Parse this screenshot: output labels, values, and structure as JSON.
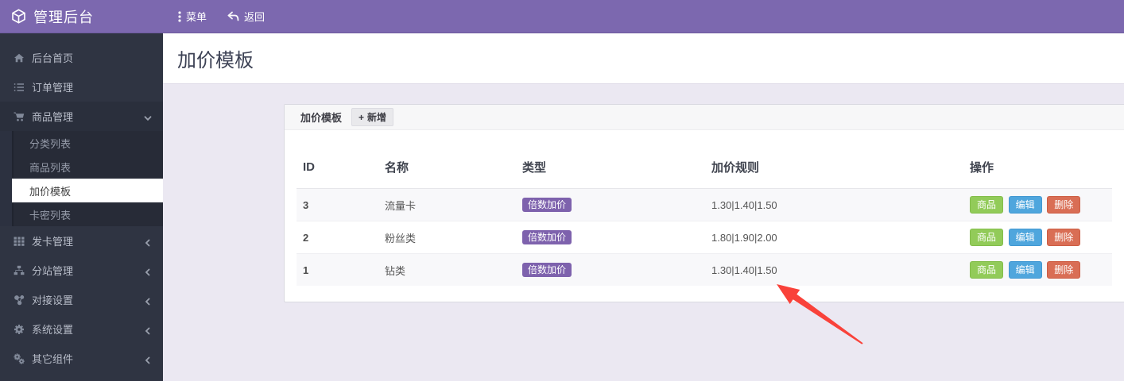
{
  "topbar": {
    "brand": "管理后台",
    "brand_icon": "cube-icon",
    "menu_label": "菜单",
    "menu_icon": "ellipsis-vertical-icon",
    "back_label": "返回",
    "back_icon": "reply-arrow-icon"
  },
  "sidebar": {
    "items": [
      {
        "label": "后台首页",
        "icon": "home-icon"
      },
      {
        "label": "订单管理",
        "icon": "list-icon"
      },
      {
        "label": "商品管理",
        "icon": "cart-icon",
        "expanded": true,
        "children": [
          {
            "label": "分类列表",
            "active": false
          },
          {
            "label": "商品列表",
            "active": false
          },
          {
            "label": "加价模板",
            "active": true
          },
          {
            "label": "卡密列表",
            "active": false
          }
        ]
      },
      {
        "label": "发卡管理",
        "icon": "grid-icon"
      },
      {
        "label": "分站管理",
        "icon": "sitemap-icon"
      },
      {
        "label": "对接设置",
        "icon": "nodes-icon"
      },
      {
        "label": "系统设置",
        "icon": "gear-icon"
      },
      {
        "label": "其它组件",
        "icon": "cogs-icon"
      }
    ]
  },
  "page": {
    "title": "加价模板"
  },
  "panel": {
    "title": "加价模板",
    "plus_glyph": "+",
    "add_label": "新增"
  },
  "table": {
    "headers": [
      "ID",
      "名称",
      "类型",
      "加价规则",
      "操作"
    ],
    "action_labels": [
      "商品",
      "编辑",
      "删除"
    ],
    "rows": [
      {
        "id": "3",
        "name": "流量卡",
        "type": "倍数加价",
        "rule": "1.30|1.40|1.50"
      },
      {
        "id": "2",
        "name": "粉丝类",
        "type": "倍数加价",
        "rule": "1.80|1.90|2.00"
      },
      {
        "id": "1",
        "name": "钻类",
        "type": "倍数加价",
        "rule": "1.30|1.40|1.50"
      }
    ]
  },
  "colors": {
    "topbar_purple": "#7c68af",
    "sidebar_dark": "#2f3442",
    "content_bg": "#ebe8f2",
    "badge_purple": "#7e62ad",
    "btn_green": "#92cb59",
    "btn_blue": "#4fa6dd",
    "btn_red": "#d96e55",
    "arrow_red": "#f9423a"
  }
}
